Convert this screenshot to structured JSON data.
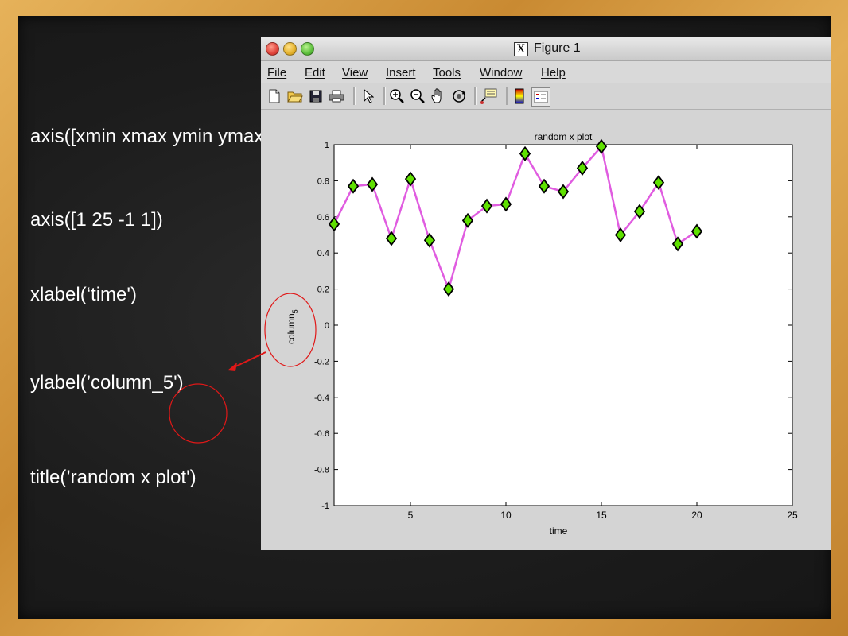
{
  "chalkboard": {
    "lines": [
      "axis([xmin  xmax  ymin  ymax])",
      "axis([1 25 -1 1])",
      "xlabel(‘time')",
      "ylabel(’column_5')",
      "title(’random x plot')"
    ]
  },
  "window": {
    "title": "Figure 1",
    "menu": [
      "File",
      "Edit",
      "View",
      "Insert",
      "Tools",
      "Window",
      "Help"
    ],
    "toolbar_icons": [
      "new-file-icon",
      "open-folder-icon",
      "save-icon",
      "print-icon",
      "pointer-icon",
      "zoom-in-icon",
      "zoom-out-icon",
      "pan-hand-icon",
      "rotate-3d-icon",
      "data-cursor-icon",
      "colorbar-icon",
      "legend-icon"
    ]
  },
  "colors": {
    "line": "#e05ce0",
    "marker_fill": "#5fe000",
    "marker_edge": "#000000",
    "annotation": "#e01818"
  },
  "chart_data": {
    "type": "line",
    "title": "random x plot",
    "xlabel": "time",
    "ylabel": "column",
    "ylabel_subscript": "5",
    "xlim": [
      1,
      25
    ],
    "ylim": [
      -1,
      1
    ],
    "xticks": [
      5,
      10,
      15,
      20,
      25
    ],
    "yticks": [
      -1,
      -0.8,
      -0.6,
      -0.4,
      -0.2,
      0,
      0.2,
      0.4,
      0.6,
      0.8,
      1
    ],
    "series": [
      {
        "x": [
          1,
          2,
          3,
          4,
          5,
          6,
          7,
          8,
          9,
          10,
          11,
          12,
          13,
          14,
          15,
          16,
          17,
          18,
          19,
          20
        ],
        "values": [
          0.56,
          0.77,
          0.78,
          0.48,
          0.81,
          0.47,
          0.2,
          0.58,
          0.66,
          0.67,
          0.95,
          0.77,
          0.74,
          0.87,
          0.99,
          0.5,
          0.63,
          0.79,
          0.45,
          0.52
        ],
        "marker": "diamond"
      }
    ],
    "grid": false
  }
}
